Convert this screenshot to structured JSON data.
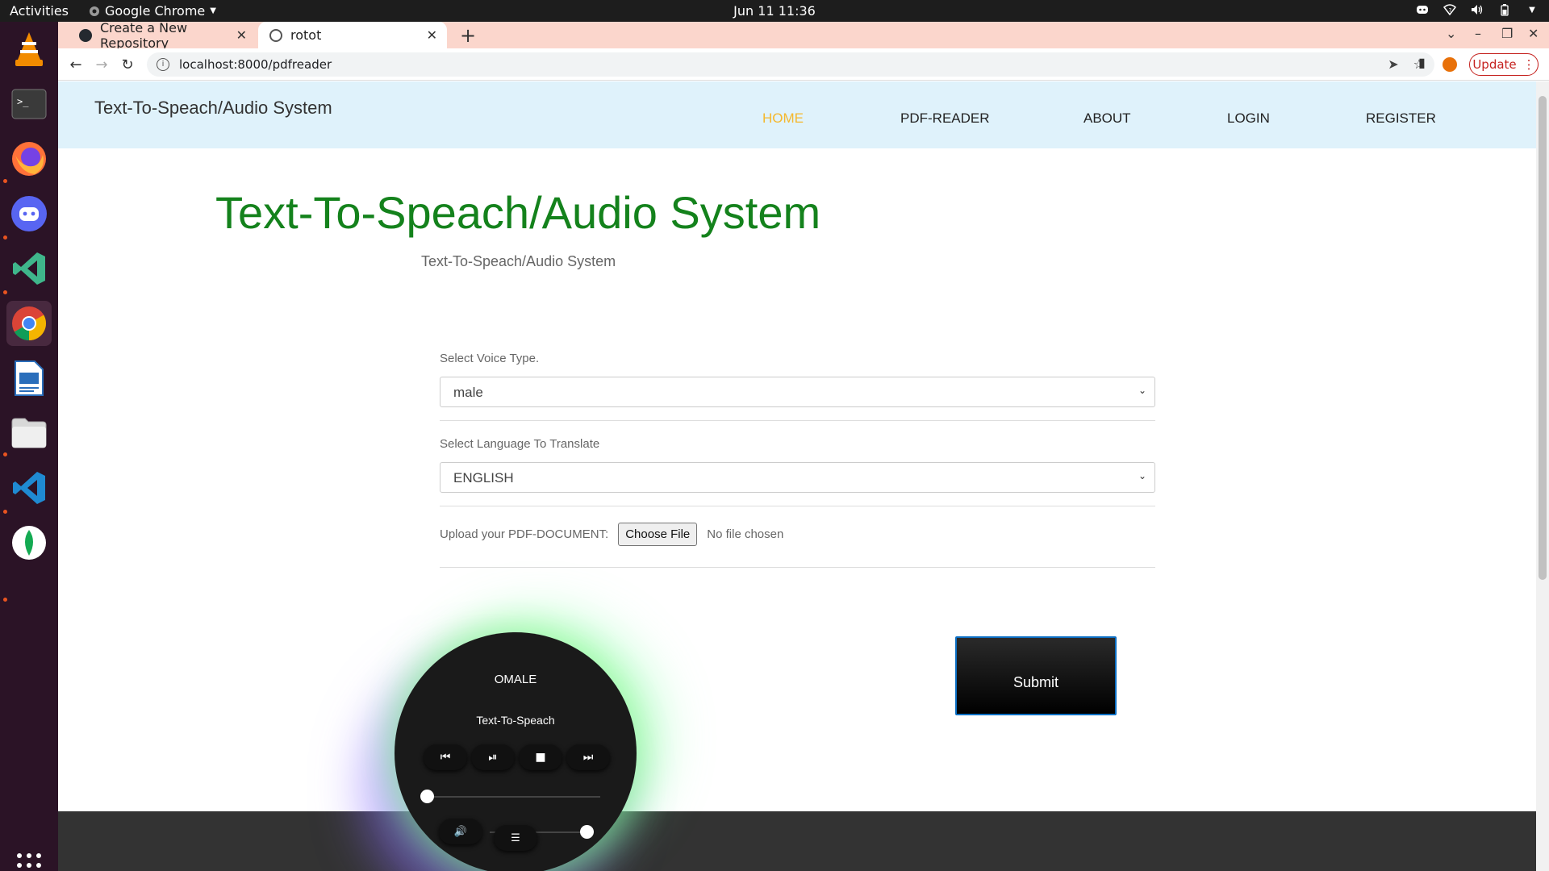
{
  "system": {
    "activities": "Activities",
    "app_name": "Google Chrome",
    "clock": "Jun 11  11:36"
  },
  "dock": {
    "items": [
      "vlc-icon",
      "terminal-icon",
      "firefox-icon",
      "discord-icon",
      "vscode-icon",
      "chrome-icon",
      "writer-icon",
      "files-icon",
      "vscode-insiders-icon",
      "mongodb-compass-icon"
    ]
  },
  "browser": {
    "tabs": [
      {
        "title": "Create a New Repository",
        "active": false
      },
      {
        "title": "rotot",
        "active": true
      }
    ],
    "url": "localhost:8000/pdfreader",
    "update_label": "Update"
  },
  "site": {
    "brand": "Text-To-Speach/Audio System",
    "nav": [
      {
        "label": "HOME",
        "active": true
      },
      {
        "label": "PDF-READER",
        "active": false
      },
      {
        "label": "ABOUT",
        "active": false
      },
      {
        "label": "LOGIN",
        "active": false
      },
      {
        "label": "REGISTER",
        "active": false
      }
    ],
    "hero_title": "Text-To-Speach/Audio System",
    "hero_subtitle": "Text-To-Speach/Audio System"
  },
  "form": {
    "voice_label": "Select Voice Type.",
    "voice_value": "male",
    "language_label": "Select Language To Translate",
    "language_value": "ENGLISH",
    "upload_label": "Upload your PDF-DOCUMENT:",
    "choose_file_label": "Choose File",
    "file_status": "No file chosen",
    "submit_label": "Submit"
  },
  "player": {
    "artist": "OMALE",
    "track": "Text-To-Speach",
    "progress": 0.0,
    "volume": 1.0
  },
  "colors": {
    "hero_green": "#14821c",
    "nav_active": "#f5b82e",
    "nav_bg": "#dff2fb",
    "tabstrip": "#fbd6cc"
  }
}
